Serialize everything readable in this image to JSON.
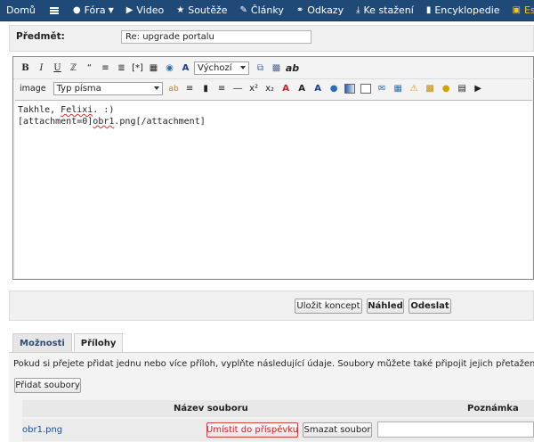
{
  "nav": {
    "items": [
      {
        "label": "Domů",
        "icon": "home-icon"
      },
      {
        "label": "",
        "icon": "menu-icon"
      },
      {
        "label": "Fóra",
        "icon": "chat-bubble-icon"
      },
      {
        "label": "Video",
        "icon": "video-camera-icon"
      },
      {
        "label": "Soutěže",
        "icon": "star-icon"
      },
      {
        "label": "Články",
        "icon": "pencil-icon"
      },
      {
        "label": "Odkazy",
        "icon": "link-icon"
      },
      {
        "label": "Ke stažení",
        "icon": "download-icon"
      },
      {
        "label": "Encyklopedie",
        "icon": "book-icon"
      },
      {
        "label": "Eshop",
        "icon": "cart-icon"
      }
    ],
    "bg_color": "#1f4a78",
    "eshop_color": "#f1c232"
  },
  "subject": {
    "label": "Předmět:",
    "value": "Re: upgrade portalu"
  },
  "toolbar": {
    "bold": "B",
    "italic": "I",
    "underline": "U",
    "size_select": "Výchozí",
    "image_label": "image",
    "font_select": "Typ písma",
    "ab": "ab"
  },
  "editor": {
    "line1_a": "Takhle, ",
    "line1_b": "Felixi",
    "line1_c": ". :)",
    "line2_a": "[attachment=0]",
    "line2_b": "obr1",
    "line2_c": ".png[/attachment]"
  },
  "actions": {
    "save_draft": "Uložit koncept",
    "preview": "Náhled",
    "submit": "Odeslat"
  },
  "tabs": {
    "options": "Možnosti",
    "attachments": "Přílohy"
  },
  "attachments": {
    "info": "Pokud si přejete přidat jednu nebo více příloh, vyplňte následující údaje. Soubory můžete také připojit jejich přetažením do textového pole.",
    "add_files": "Přidat soubory",
    "col_name": "Název souboru",
    "col_note": "Poznámka",
    "files": [
      {
        "name": "obr1.png",
        "place": "Umístit do příspěvku",
        "delete": "Smazat soubor"
      }
    ]
  }
}
